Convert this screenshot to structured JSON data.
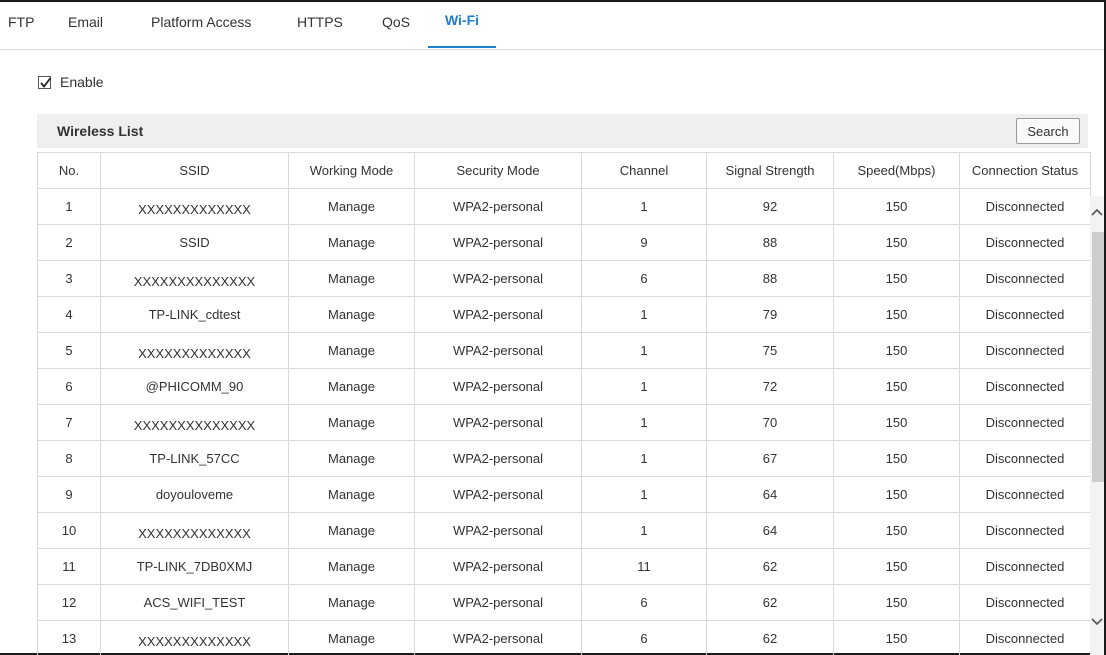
{
  "tabs": [
    {
      "label": "FTP",
      "active": false
    },
    {
      "label": "Email",
      "active": false
    },
    {
      "label": "Platform Access",
      "active": false
    },
    {
      "label": "HTTPS",
      "active": false
    },
    {
      "label": "QoS",
      "active": false
    },
    {
      "label": "Wi-Fi",
      "active": true
    }
  ],
  "enable": {
    "label": "Enable",
    "checked": true
  },
  "wireless_list": {
    "title": "Wireless List",
    "search_label": "Search",
    "columns": [
      "No.",
      "SSID",
      "Working Mode",
      "Security Mode",
      "Channel",
      "Signal Strength",
      "Speed(Mbps)",
      "Connection Status"
    ],
    "rows": [
      {
        "no": "1",
        "ssid": "XXXXXXXXXXXXX",
        "mode": "Manage",
        "security": "WPA2-personal",
        "channel": "1",
        "signal": "92",
        "speed": "150",
        "status": "Disconnected"
      },
      {
        "no": "2",
        "ssid": "SSID",
        "mode": "Manage",
        "security": "WPA2-personal",
        "channel": "9",
        "signal": "88",
        "speed": "150",
        "status": "Disconnected"
      },
      {
        "no": "3",
        "ssid": "XXXXXXXXXXXXXX",
        "mode": "Manage",
        "security": "WPA2-personal",
        "channel": "6",
        "signal": "88",
        "speed": "150",
        "status": "Disconnected"
      },
      {
        "no": "4",
        "ssid": "TP-LINK_cdtest",
        "mode": "Manage",
        "security": "WPA2-personal",
        "channel": "1",
        "signal": "79",
        "speed": "150",
        "status": "Disconnected"
      },
      {
        "no": "5",
        "ssid": "XXXXXXXXXXXXX",
        "mode": "Manage",
        "security": "WPA2-personal",
        "channel": "1",
        "signal": "75",
        "speed": "150",
        "status": "Disconnected"
      },
      {
        "no": "6",
        "ssid": "@PHICOMM_90",
        "mode": "Manage",
        "security": "WPA2-personal",
        "channel": "1",
        "signal": "72",
        "speed": "150",
        "status": "Disconnected"
      },
      {
        "no": "7",
        "ssid": "XXXXXXXXXXXXXX",
        "mode": "Manage",
        "security": "WPA2-personal",
        "channel": "1",
        "signal": "70",
        "speed": "150",
        "status": "Disconnected"
      },
      {
        "no": "8",
        "ssid": "TP-LINK_57CC",
        "mode": "Manage",
        "security": "WPA2-personal",
        "channel": "1",
        "signal": "67",
        "speed": "150",
        "status": "Disconnected"
      },
      {
        "no": "9",
        "ssid": "doyouloveme",
        "mode": "Manage",
        "security": "WPA2-personal",
        "channel": "1",
        "signal": "64",
        "speed": "150",
        "status": "Disconnected"
      },
      {
        "no": "10",
        "ssid": "XXXXXXXXXXXXX",
        "mode": "Manage",
        "security": "WPA2-personal",
        "channel": "1",
        "signal": "64",
        "speed": "150",
        "status": "Disconnected"
      },
      {
        "no": "11",
        "ssid": "TP-LINK_7DB0XMJ",
        "mode": "Manage",
        "security": "WPA2-personal",
        "channel": "11",
        "signal": "62",
        "speed": "150",
        "status": "Disconnected"
      },
      {
        "no": "12",
        "ssid": "ACS_WIFI_TEST",
        "mode": "Manage",
        "security": "WPA2-personal",
        "channel": "6",
        "signal": "62",
        "speed": "150",
        "status": "Disconnected"
      },
      {
        "no": "13",
        "ssid": "XXXXXXXXXXXXX",
        "mode": "Manage",
        "security": "WPA2-personal",
        "channel": "6",
        "signal": "62",
        "speed": "150",
        "status": "Disconnected"
      }
    ]
  },
  "icons": {
    "checkbox": "checkmark-icon",
    "scroll_up": "chevron-up-icon",
    "scroll_down": "chevron-down-icon"
  },
  "colors": {
    "accent": "#1e7ed2",
    "header_bg": "#efefef",
    "border": "#d9d9d9"
  }
}
